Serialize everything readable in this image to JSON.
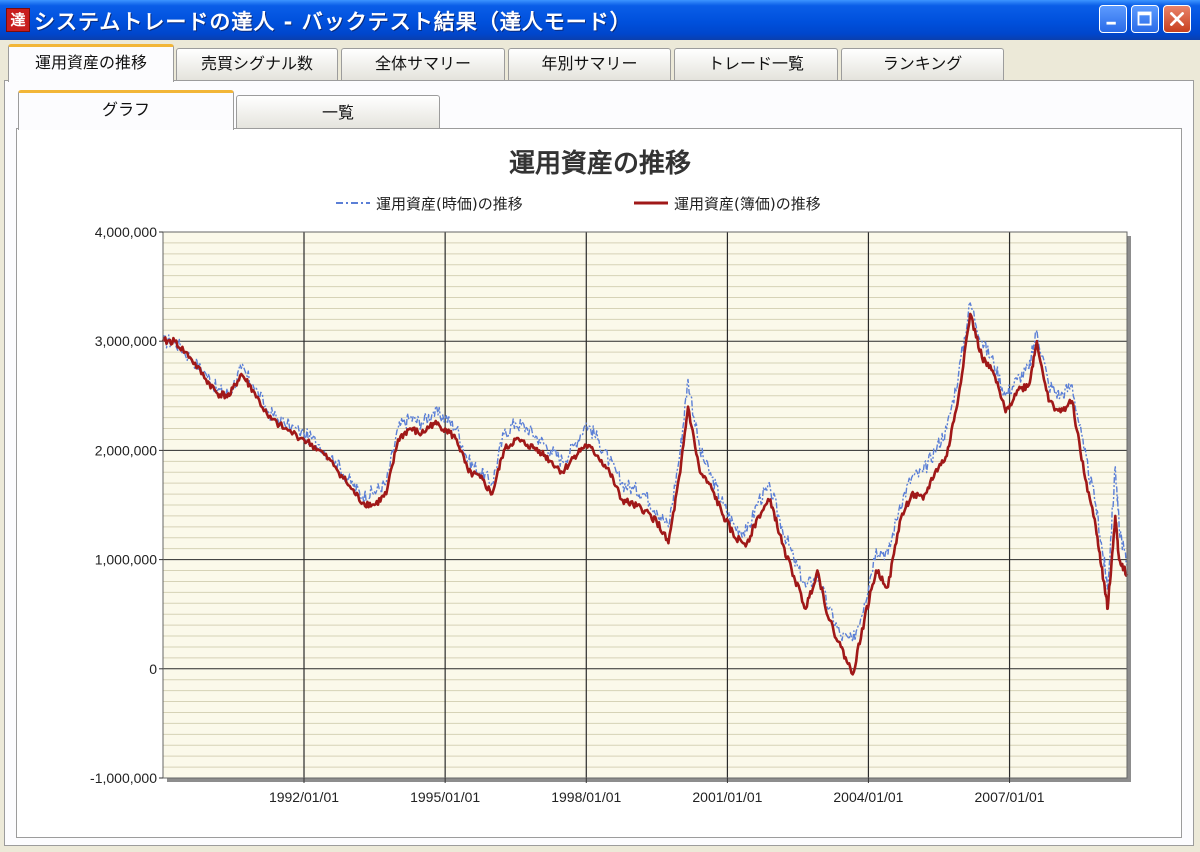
{
  "window": {
    "title": "システムトレードの達人 - バックテスト結果（達人モード）",
    "app_icon_glyph": "達",
    "controls": [
      "minimize",
      "maximize",
      "close"
    ]
  },
  "tabs": [
    {
      "label": "運用資産の推移",
      "active": true
    },
    {
      "label": "売買シグナル数",
      "active": false
    },
    {
      "label": "全体サマリー",
      "active": false
    },
    {
      "label": "年別サマリー",
      "active": false
    },
    {
      "label": "トレード一覧",
      "active": false
    },
    {
      "label": "ランキング",
      "active": false
    }
  ],
  "subtabs": [
    {
      "label": "グラフ",
      "active": true
    },
    {
      "label": "一覧",
      "active": false
    }
  ],
  "colors": {
    "plot_background": "#fbf9ea",
    "market_value_series": "#5b7fd6",
    "book_value_series": "#a01818",
    "gridline_major": "#2b2b2b",
    "gridline_minor": "#d6d2b6"
  },
  "chart_data": {
    "type": "line",
    "title": "運用資産の推移",
    "legend": {
      "placement": "top"
    },
    "xlabel": "",
    "ylabel": "",
    "xlim": [
      "1989/01/01",
      "2009/07/01"
    ],
    "ylim": [
      -1000000,
      4000000
    ],
    "y_ticks": [
      -1000000,
      0,
      1000000,
      2000000,
      3000000,
      4000000
    ],
    "y_tick_labels": [
      "-1,000,000",
      "0",
      "1,000,000",
      "2,000,000",
      "3,000,000",
      "4,000,000"
    ],
    "x_ticks": [
      "1992/01/01",
      "1995/01/01",
      "1998/01/01",
      "2001/01/01",
      "2004/01/01",
      "2007/01/01"
    ],
    "grid": true,
    "series": [
      {
        "name": "運用資産(時価)の推移",
        "style": "dash-dot",
        "points": [
          [
            "1989/01/01",
            3000000
          ],
          [
            "1989/04/01",
            3000000
          ],
          [
            "1989/08/01",
            2850000
          ],
          [
            "1989/12/01",
            2700000
          ],
          [
            "1990/03/01",
            2550000
          ],
          [
            "1990/06/01",
            2520000
          ],
          [
            "1990/09/01",
            2750000
          ],
          [
            "1990/12/01",
            2600000
          ],
          [
            "1991/04/01",
            2350000
          ],
          [
            "1991/08/01",
            2250000
          ],
          [
            "1992/01/01",
            2150000
          ],
          [
            "1992/05/01",
            2050000
          ],
          [
            "1992/09/01",
            1900000
          ],
          [
            "1993/01/01",
            1700000
          ],
          [
            "1993/04/01",
            1580000
          ],
          [
            "1993/07/01",
            1620000
          ],
          [
            "1993/10/01",
            1700000
          ],
          [
            "1994/01/01",
            2200000
          ],
          [
            "1994/04/01",
            2300000
          ],
          [
            "1994/07/01",
            2250000
          ],
          [
            "1994/10/01",
            2350000
          ],
          [
            "1995/01/01",
            2300000
          ],
          [
            "1995/04/01",
            2200000
          ],
          [
            "1995/07/01",
            1900000
          ],
          [
            "1995/10/01",
            1800000
          ],
          [
            "1996/01/01",
            1700000
          ],
          [
            "1996/04/01",
            2150000
          ],
          [
            "1996/07/01",
            2250000
          ],
          [
            "1996/10/01",
            2200000
          ],
          [
            "1997/01/01",
            2100000
          ],
          [
            "1997/04/01",
            2000000
          ],
          [
            "1997/07/01",
            1900000
          ],
          [
            "1997/10/01",
            2050000
          ],
          [
            "1998/01/01",
            2250000
          ],
          [
            "1998/04/01",
            2100000
          ],
          [
            "1998/07/01",
            1900000
          ],
          [
            "1998/10/01",
            1700000
          ],
          [
            "1999/01/01",
            1650000
          ],
          [
            "1999/04/01",
            1600000
          ],
          [
            "1999/07/01",
            1450000
          ],
          [
            "1999/10/01",
            1300000
          ],
          [
            "2000/01/01",
            2000000
          ],
          [
            "2000/03/01",
            2650000
          ],
          [
            "2000/06/01",
            2000000
          ],
          [
            "2000/09/01",
            1750000
          ],
          [
            "2000/12/01",
            1500000
          ],
          [
            "2001/03/01",
            1300000
          ],
          [
            "2001/06/01",
            1250000
          ],
          [
            "2001/09/01",
            1550000
          ],
          [
            "2001/12/01",
            1650000
          ],
          [
            "2002/03/01",
            1300000
          ],
          [
            "2002/06/01",
            1000000
          ],
          [
            "2002/09/01",
            750000
          ],
          [
            "2002/12/01",
            850000
          ],
          [
            "2003/03/01",
            550000
          ],
          [
            "2003/06/01",
            300000
          ],
          [
            "2003/09/01",
            250000
          ],
          [
            "2003/12/01",
            600000
          ],
          [
            "2004/03/01",
            1100000
          ],
          [
            "2004/06/01",
            1050000
          ],
          [
            "2004/09/01",
            1500000
          ],
          [
            "2004/12/01",
            1750000
          ],
          [
            "2005/03/01",
            1800000
          ],
          [
            "2005/06/01",
            2000000
          ],
          [
            "2005/09/01",
            2200000
          ],
          [
            "2005/12/01",
            2700000
          ],
          [
            "2006/03/01",
            3350000
          ],
          [
            "2006/06/01",
            3000000
          ],
          [
            "2006/09/01",
            2800000
          ],
          [
            "2006/12/01",
            2500000
          ],
          [
            "2007/03/01",
            2650000
          ],
          [
            "2007/06/01",
            2750000
          ],
          [
            "2007/08/01",
            3100000
          ],
          [
            "2007/11/01",
            2600000
          ],
          [
            "2008/02/01",
            2500000
          ],
          [
            "2008/05/01",
            2600000
          ],
          [
            "2008/08/01",
            2000000
          ],
          [
            "2008/11/01",
            1500000
          ],
          [
            "2009/01/01",
            1000000
          ],
          [
            "2009/02/01",
            750000
          ],
          [
            "2009/04/01",
            1850000
          ],
          [
            "2009/05/01",
            1300000
          ],
          [
            "2009/07/01",
            950000
          ]
        ]
      },
      {
        "name": "運用資産(簿価)の推移",
        "style": "solid",
        "points": [
          [
            "1989/01/01",
            3000000
          ],
          [
            "1989/04/01",
            3000000
          ],
          [
            "1989/08/01",
            2850000
          ],
          [
            "1989/12/01",
            2650000
          ],
          [
            "1990/03/01",
            2520000
          ],
          [
            "1990/06/01",
            2500000
          ],
          [
            "1990/09/01",
            2700000
          ],
          [
            "1990/12/01",
            2550000
          ],
          [
            "1991/04/01",
            2300000
          ],
          [
            "1991/08/01",
            2200000
          ],
          [
            "1992/01/01",
            2100000
          ],
          [
            "1992/05/01",
            2000000
          ],
          [
            "1992/09/01",
            1850000
          ],
          [
            "1993/01/01",
            1650000
          ],
          [
            "1993/04/01",
            1520000
          ],
          [
            "1993/07/01",
            1500000
          ],
          [
            "1993/10/01",
            1600000
          ],
          [
            "1994/01/01",
            2100000
          ],
          [
            "1994/04/01",
            2200000
          ],
          [
            "1994/07/01",
            2150000
          ],
          [
            "1994/10/01",
            2250000
          ],
          [
            "1995/01/01",
            2200000
          ],
          [
            "1995/04/01",
            2100000
          ],
          [
            "1995/07/01",
            1800000
          ],
          [
            "1995/10/01",
            1750000
          ],
          [
            "1996/01/01",
            1600000
          ],
          [
            "1996/04/01",
            2000000
          ],
          [
            "1996/07/01",
            2100000
          ],
          [
            "1996/10/01",
            2050000
          ],
          [
            "1997/01/01",
            2000000
          ],
          [
            "1997/04/01",
            1900000
          ],
          [
            "1997/07/01",
            1800000
          ],
          [
            "1997/10/01",
            1950000
          ],
          [
            "1998/01/01",
            2050000
          ],
          [
            "1998/04/01",
            1950000
          ],
          [
            "1998/07/01",
            1800000
          ],
          [
            "1998/10/01",
            1550000
          ],
          [
            "1999/01/01",
            1500000
          ],
          [
            "1999/04/01",
            1450000
          ],
          [
            "1999/07/01",
            1350000
          ],
          [
            "1999/10/01",
            1150000
          ],
          [
            "2000/01/01",
            1800000
          ],
          [
            "2000/03/01",
            2400000
          ],
          [
            "2000/06/01",
            1800000
          ],
          [
            "2000/09/01",
            1650000
          ],
          [
            "2000/12/01",
            1400000
          ],
          [
            "2001/03/01",
            1200000
          ],
          [
            "2001/06/01",
            1150000
          ],
          [
            "2001/09/01",
            1400000
          ],
          [
            "2001/12/01",
            1550000
          ],
          [
            "2002/03/01",
            1150000
          ],
          [
            "2002/06/01",
            850000
          ],
          [
            "2002/09/01",
            550000
          ],
          [
            "2002/12/01",
            900000
          ],
          [
            "2003/03/01",
            450000
          ],
          [
            "2003/06/01",
            200000
          ],
          [
            "2003/09/01",
            -50000
          ],
          [
            "2003/12/01",
            450000
          ],
          [
            "2004/03/01",
            900000
          ],
          [
            "2004/06/01",
            750000
          ],
          [
            "2004/09/01",
            1350000
          ],
          [
            "2004/12/01",
            1600000
          ],
          [
            "2005/03/01",
            1550000
          ],
          [
            "2005/06/01",
            1800000
          ],
          [
            "2005/09/01",
            1950000
          ],
          [
            "2005/12/01",
            2500000
          ],
          [
            "2006/03/01",
            3250000
          ],
          [
            "2006/06/01",
            2850000
          ],
          [
            "2006/09/01",
            2700000
          ],
          [
            "2006/12/01",
            2350000
          ],
          [
            "2007/03/01",
            2550000
          ],
          [
            "2007/06/01",
            2600000
          ],
          [
            "2007/08/01",
            3000000
          ],
          [
            "2007/11/01",
            2450000
          ],
          [
            "2008/02/01",
            2350000
          ],
          [
            "2008/05/01",
            2450000
          ],
          [
            "2008/08/01",
            1800000
          ],
          [
            "2008/11/01",
            1300000
          ],
          [
            "2009/01/01",
            800000
          ],
          [
            "2009/02/01",
            550000
          ],
          [
            "2009/04/01",
            1400000
          ],
          [
            "2009/05/01",
            1000000
          ],
          [
            "2009/07/01",
            870000
          ]
        ]
      }
    ]
  }
}
